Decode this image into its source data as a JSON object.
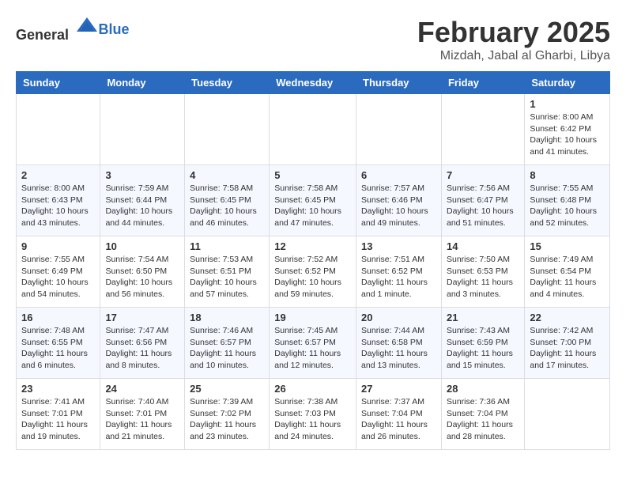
{
  "header": {
    "logo_general": "General",
    "logo_blue": "Blue",
    "month_title": "February 2025",
    "location": "Mizdah, Jabal al Gharbi, Libya"
  },
  "days_of_week": [
    "Sunday",
    "Monday",
    "Tuesday",
    "Wednesday",
    "Thursday",
    "Friday",
    "Saturday"
  ],
  "weeks": [
    [
      {
        "day": "",
        "info": ""
      },
      {
        "day": "",
        "info": ""
      },
      {
        "day": "",
        "info": ""
      },
      {
        "day": "",
        "info": ""
      },
      {
        "day": "",
        "info": ""
      },
      {
        "day": "",
        "info": ""
      },
      {
        "day": "1",
        "info": "Sunrise: 8:00 AM\nSunset: 6:42 PM\nDaylight: 10 hours\nand 41 minutes."
      }
    ],
    [
      {
        "day": "2",
        "info": "Sunrise: 8:00 AM\nSunset: 6:43 PM\nDaylight: 10 hours\nand 43 minutes."
      },
      {
        "day": "3",
        "info": "Sunrise: 7:59 AM\nSunset: 6:44 PM\nDaylight: 10 hours\nand 44 minutes."
      },
      {
        "day": "4",
        "info": "Sunrise: 7:58 AM\nSunset: 6:45 PM\nDaylight: 10 hours\nand 46 minutes."
      },
      {
        "day": "5",
        "info": "Sunrise: 7:58 AM\nSunset: 6:45 PM\nDaylight: 10 hours\nand 47 minutes."
      },
      {
        "day": "6",
        "info": "Sunrise: 7:57 AM\nSunset: 6:46 PM\nDaylight: 10 hours\nand 49 minutes."
      },
      {
        "day": "7",
        "info": "Sunrise: 7:56 AM\nSunset: 6:47 PM\nDaylight: 10 hours\nand 51 minutes."
      },
      {
        "day": "8",
        "info": "Sunrise: 7:55 AM\nSunset: 6:48 PM\nDaylight: 10 hours\nand 52 minutes."
      }
    ],
    [
      {
        "day": "9",
        "info": "Sunrise: 7:55 AM\nSunset: 6:49 PM\nDaylight: 10 hours\nand 54 minutes."
      },
      {
        "day": "10",
        "info": "Sunrise: 7:54 AM\nSunset: 6:50 PM\nDaylight: 10 hours\nand 56 minutes."
      },
      {
        "day": "11",
        "info": "Sunrise: 7:53 AM\nSunset: 6:51 PM\nDaylight: 10 hours\nand 57 minutes."
      },
      {
        "day": "12",
        "info": "Sunrise: 7:52 AM\nSunset: 6:52 PM\nDaylight: 10 hours\nand 59 minutes."
      },
      {
        "day": "13",
        "info": "Sunrise: 7:51 AM\nSunset: 6:52 PM\nDaylight: 11 hours\nand 1 minute."
      },
      {
        "day": "14",
        "info": "Sunrise: 7:50 AM\nSunset: 6:53 PM\nDaylight: 11 hours\nand 3 minutes."
      },
      {
        "day": "15",
        "info": "Sunrise: 7:49 AM\nSunset: 6:54 PM\nDaylight: 11 hours\nand 4 minutes."
      }
    ],
    [
      {
        "day": "16",
        "info": "Sunrise: 7:48 AM\nSunset: 6:55 PM\nDaylight: 11 hours\nand 6 minutes."
      },
      {
        "day": "17",
        "info": "Sunrise: 7:47 AM\nSunset: 6:56 PM\nDaylight: 11 hours\nand 8 minutes."
      },
      {
        "day": "18",
        "info": "Sunrise: 7:46 AM\nSunset: 6:57 PM\nDaylight: 11 hours\nand 10 minutes."
      },
      {
        "day": "19",
        "info": "Sunrise: 7:45 AM\nSunset: 6:57 PM\nDaylight: 11 hours\nand 12 minutes."
      },
      {
        "day": "20",
        "info": "Sunrise: 7:44 AM\nSunset: 6:58 PM\nDaylight: 11 hours\nand 13 minutes."
      },
      {
        "day": "21",
        "info": "Sunrise: 7:43 AM\nSunset: 6:59 PM\nDaylight: 11 hours\nand 15 minutes."
      },
      {
        "day": "22",
        "info": "Sunrise: 7:42 AM\nSunset: 7:00 PM\nDaylight: 11 hours\nand 17 minutes."
      }
    ],
    [
      {
        "day": "23",
        "info": "Sunrise: 7:41 AM\nSunset: 7:01 PM\nDaylight: 11 hours\nand 19 minutes."
      },
      {
        "day": "24",
        "info": "Sunrise: 7:40 AM\nSunset: 7:01 PM\nDaylight: 11 hours\nand 21 minutes."
      },
      {
        "day": "25",
        "info": "Sunrise: 7:39 AM\nSunset: 7:02 PM\nDaylight: 11 hours\nand 23 minutes."
      },
      {
        "day": "26",
        "info": "Sunrise: 7:38 AM\nSunset: 7:03 PM\nDaylight: 11 hours\nand 24 minutes."
      },
      {
        "day": "27",
        "info": "Sunrise: 7:37 AM\nSunset: 7:04 PM\nDaylight: 11 hours\nand 26 minutes."
      },
      {
        "day": "28",
        "info": "Sunrise: 7:36 AM\nSunset: 7:04 PM\nDaylight: 11 hours\nand 28 minutes."
      },
      {
        "day": "",
        "info": ""
      }
    ]
  ]
}
